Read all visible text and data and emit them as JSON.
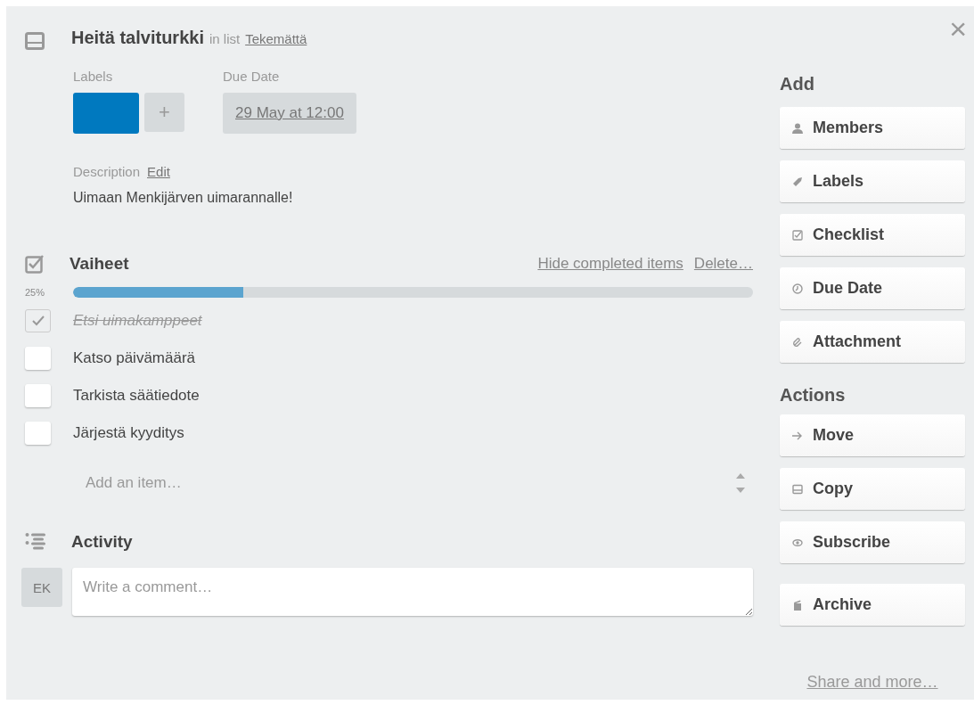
{
  "card": {
    "title": "Heitä talviturkki",
    "list_prefix": "in list",
    "list_name": "Tekemättä",
    "close": "×"
  },
  "labels": {
    "heading": "Labels",
    "items": [
      {
        "color": "#0079bf"
      }
    ],
    "add": "+"
  },
  "due_date": {
    "heading": "Due Date",
    "value": "29 May at 12:00"
  },
  "description": {
    "heading": "Description",
    "edit": "Edit",
    "text": "Uimaan Menkijärven uimarannalle!"
  },
  "checklist": {
    "title": "Vaiheet",
    "hide": "Hide completed items",
    "delete": "Delete…",
    "percent": "25%",
    "level": 0.25,
    "items": [
      {
        "text": "Etsi uimakamppeet",
        "checked": true
      },
      {
        "text": "Katso päivämäärä",
        "checked": false
      },
      {
        "text": "Tarkista säätiedote",
        "checked": false
      },
      {
        "text": "Järjestä kyyditys",
        "checked": false
      }
    ],
    "add_placeholder": "Add an item…"
  },
  "activity": {
    "title": "Activity",
    "avatar": "EK",
    "placeholder": "Write a comment…"
  },
  "sidebar": {
    "add_heading": "Add",
    "add_buttons": [
      {
        "label": "Members"
      },
      {
        "label": "Labels"
      },
      {
        "label": "Checklist"
      },
      {
        "label": "Due Date"
      },
      {
        "label": "Attachment"
      }
    ],
    "actions_heading": "Actions",
    "action_buttons": [
      {
        "label": "Move"
      },
      {
        "label": "Copy"
      },
      {
        "label": "Subscribe"
      },
      {
        "label": "Archive"
      }
    ],
    "share": "Share and more…"
  }
}
